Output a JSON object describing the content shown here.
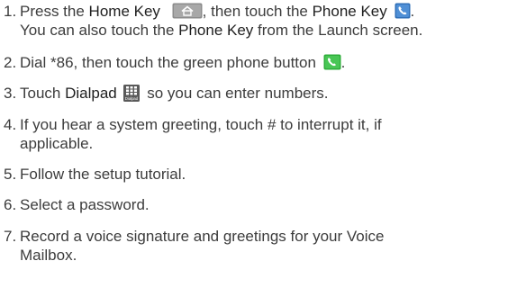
{
  "steps": [
    {
      "num": "1.",
      "t1": "Press the ",
      "home_key": "Home Key",
      "t2": ", then touch the ",
      "phone_key": "Phone Key",
      "t3": ".",
      "line2a": "You can also touch the ",
      "line2_phone_key": "Phone Key",
      "line2b": " from the Launch screen."
    },
    {
      "num": "2.",
      "t1": "Dial *86, then touch the green phone button",
      "t2": "."
    },
    {
      "num": "3.",
      "t1": "Touch ",
      "dialpad": "Dialpad",
      "t2": " so you can enter numbers.",
      "icon_caption": "Dialpad"
    },
    {
      "num": "4.",
      "t1": "If you hear a system greeting, touch # to interrupt it, if",
      "t2": "applicable."
    },
    {
      "num": "5.",
      "t1": "Follow the setup tutorial."
    },
    {
      "num": "6.",
      "t1": "Select a password."
    },
    {
      "num": "7.",
      "t1": "Record a voice signature and greetings for your Voice",
      "t2": "Mailbox."
    }
  ],
  "icons": {
    "home": "home-key-icon",
    "phone": "phone-key-icon",
    "green_phone": "green-phone-button-icon",
    "dialpad": "dialpad-icon"
  },
  "colors": {
    "text": "#3c3c3c",
    "phone_key_blue": "#2f6fb8",
    "green_button": "#2fae3b",
    "home_key_gray": "#8c8c8c"
  }
}
